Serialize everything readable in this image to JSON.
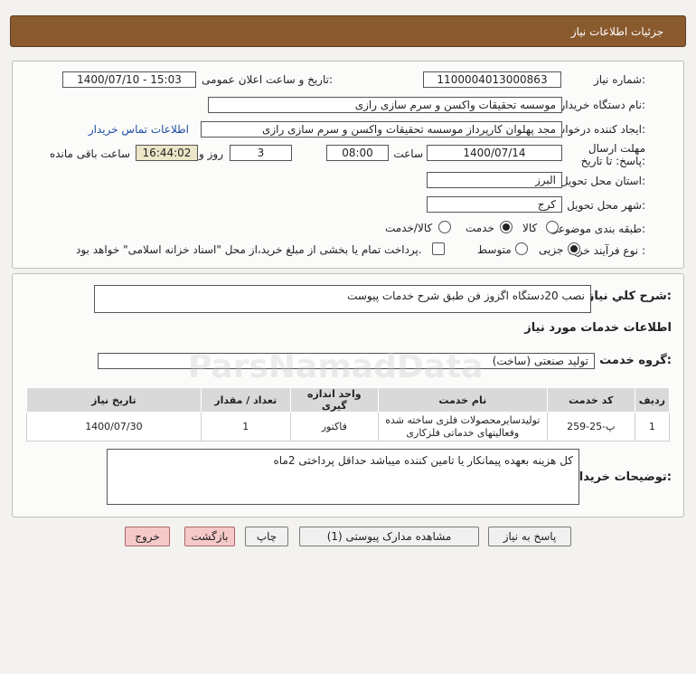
{
  "header": {
    "title": "جزئیات اطلاعات نیاز"
  },
  "need_number": {
    "label": "شماره نیاز:",
    "value": "1100004013000863"
  },
  "announce_datetime": {
    "label": "تاریخ و ساعت اعلان عمومی:",
    "value": "1400/07/10 - 15:03"
  },
  "buyer_org": {
    "label": "نام دستگاه خریدار:",
    "value": "موسسه تحقیقات واکسن و سرم سازی رازی"
  },
  "creator": {
    "label": "ایجاد کننده درخواست:",
    "value": "مجد پهلوان  کارپرداز موسسه تحقیقات واکسن و سرم سازی رازی",
    "contact_link": "اطلاعات تماس خریدار"
  },
  "deadline": {
    "label": "مهلت ارسال پاسخ: تا تاریخ:",
    "date": "1400/07/14",
    "time_label": "ساعت",
    "time": "08:00",
    "days": "3",
    "days_label": "روز و",
    "remaining": "16:44:02",
    "remaining_label": "ساعت باقی مانده"
  },
  "province": {
    "label": "استان محل تحویل:",
    "value": "البرز"
  },
  "city": {
    "label": "شهر محل تحویل:",
    "value": "کرج"
  },
  "category": {
    "label": "طبقه بندی موضوعی:",
    "options": [
      "کالا",
      "خدمت",
      "کالا/خدمت"
    ],
    "selected": "خدمت"
  },
  "purchase_type": {
    "label": "نوع فرآیند خرید :",
    "options": [
      "جزیی",
      "متوسط"
    ],
    "selected": "جزیی",
    "checkbox_label": "پرداخت تمام یا بخشی از مبلغ خرید،از محل \"اسناد خزانه اسلامی\" خواهد بود."
  },
  "general_desc": {
    "label": "شرح کلي نياز:",
    "value": "نصب 20دستگاه اگزوز فن طبق شرح خدمات پیوست"
  },
  "services_title": "اطلاعات خدمات مورد نیاز",
  "service_group": {
    "label": "گروه خدمت:",
    "value": "تولید صنعتی (ساخت)"
  },
  "table": {
    "headers": [
      "ردیف",
      "کد خدمت",
      "نام خدمت",
      "واحد اندازه گیری",
      "تعداد / مقدار",
      "تاریخ نیاز"
    ],
    "rows": [
      [
        "1",
        "پ-25-259",
        "تولیدسایرمحصولات فلزی ساخته شده وفعالیتهای خدماتی فلزکاری",
        "فاکتور",
        "1",
        "1400/07/30"
      ]
    ]
  },
  "buyer_notes": {
    "label": "توضیحات خریدار:",
    "value": "کل هزینه بعهده پیمانکار یا تامین کننده میباشد حداقل پرداختی 2ماه"
  },
  "buttons": {
    "reply": "پاسخ به نیاز",
    "attachments": "مشاهده مدارک پیوستی (1)",
    "print": "چاپ",
    "back": "بازگشت",
    "exit": "خروج"
  },
  "watermark": {
    "text": "ParsNamadData"
  },
  "colors": {
    "header": "#8a5a2f",
    "link": "#1f4ea3",
    "remaining_bg": "#ece6c8",
    "pink_button": "#f6c9c9"
  }
}
